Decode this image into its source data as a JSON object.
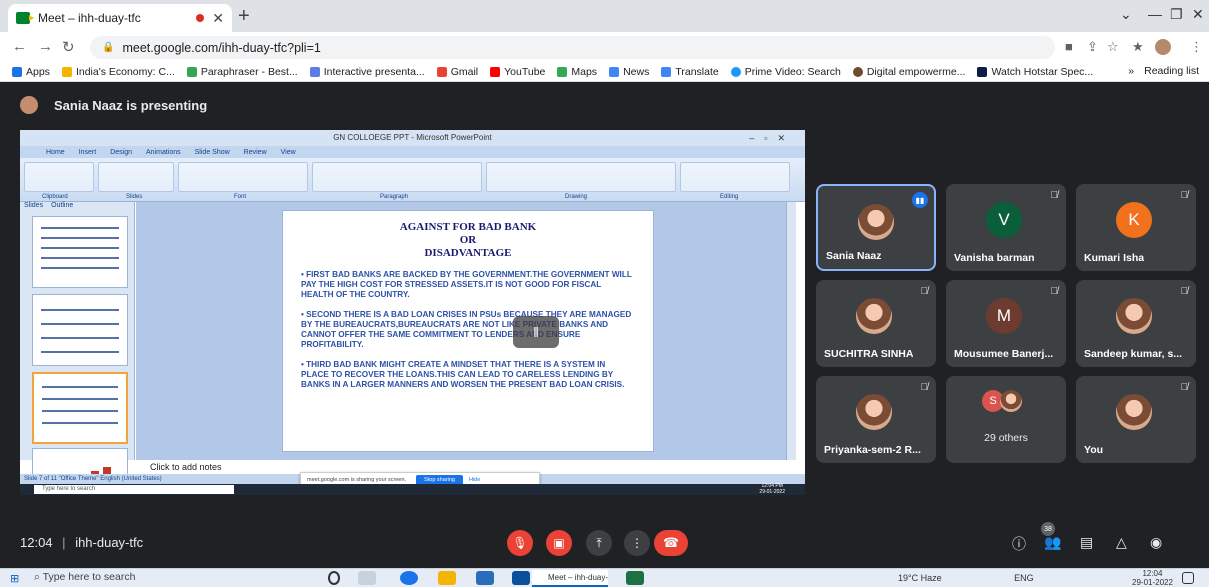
{
  "browser": {
    "tab_title": "Meet – ihh-duay-tfc",
    "url": "meet.google.com/ihh-duay-tfc?pli=1",
    "bookmarks": [
      "Apps",
      "India's Economy: C...",
      "Paraphraser - Best...",
      "Interactive presenta...",
      "Gmail",
      "YouTube",
      "Maps",
      "News",
      "Translate",
      "Prime Video: Search",
      "Digital empowerme...",
      "Watch Hotstar Spec..."
    ],
    "reading_list": "Reading list",
    "more": "»"
  },
  "meet": {
    "presenter_text": "Sania Naaz is presenting",
    "meeting_time": "12:04",
    "meeting_code": "ihh-duay-tfc",
    "participants_count": "38",
    "tiles": [
      {
        "name": "Sania Naaz",
        "initial": "",
        "color": "#3c4043",
        "muted": false,
        "speaking": true
      },
      {
        "name": "Vanisha barman",
        "initial": "V",
        "color": "#0b5e3a",
        "muted": true
      },
      {
        "name": "Kumari Isha",
        "initial": "K",
        "color": "#f2711c",
        "muted": true
      },
      {
        "name": "SUCHITRA SINHA",
        "initial": "",
        "color": "#3c4043",
        "muted": true
      },
      {
        "name": "Mousumee Banerj...",
        "initial": "M",
        "color": "#6d3b2f",
        "muted": true
      },
      {
        "name": "Sandeep kumar, s...",
        "initial": "",
        "color": "#3c4043",
        "muted": true
      },
      {
        "name": "Priyanka-sem-2 R...",
        "initial": "",
        "color": "#3c4043",
        "muted": true
      },
      {
        "name": "29 others",
        "initial": "S",
        "color": "#d9534f",
        "muted": false
      },
      {
        "name": "You",
        "initial": "",
        "color": "#3c4043",
        "muted": true
      }
    ]
  },
  "ppt": {
    "window_title": "GN COLLOEGE PPT - Microsoft PowerPoint",
    "tabs": [
      "Home",
      "Insert",
      "Design",
      "Animations",
      "Slide Show",
      "Review",
      "View"
    ],
    "groups": [
      "Clipboard",
      "Slides",
      "Font",
      "Paragraph",
      "Drawing",
      "Editing"
    ],
    "pane_tabs": [
      "Slides",
      "Outline"
    ],
    "slide_title_1": "AGAINST FOR BAD BANK",
    "slide_title_2": "OR",
    "slide_title_3": "DISADVANTAGE",
    "point_1": "• FIRST BAD BANKS ARE BACKED BY THE GOVERNMENT.THE GOVERNMENT WILL PAY THE HIGH COST FOR STRESSED ASSETS.IT IS NOT GOOD FOR FISCAL HEALTH OF THE COUNTRY.",
    "point_2": "• SECOND THERE IS A BAD LOAN CRISES IN PSUs BECAUSE THEY ARE MANAGED BY THE BUREAUCRATS,BUREAUCRATS ARE NOT LIKE PRIVATE BANKS AND CANNOT OFFER THE SAME COMMITMENT TO LENDERS AND ENSURE PROFITABILITY.",
    "point_3": "• THIRD BAD BANK MIGHT CREATE A MINDSET THAT THERE IS A SYSTEM IN PLACE TO RECOVER THE LOANS.THIS CAN LEAD TO CARELESS LENDING BY BANKS IN A LARGER MANNERS AND WORSEN THE PRESENT BAD LOAN CRISIS.",
    "notes": "Click to add notes",
    "status": "Slide 7 of 11   \"Office Theme\"   English (United States)",
    "sharing_text": "meet.google.com is sharing your screen.",
    "stop_sharing": "Stop sharing",
    "hide": "Hide",
    "inner_search": "Type here to search",
    "inner_clock": "12:04 PM",
    "inner_date": "29-01-2022"
  },
  "taskbar": {
    "search": "Type here to search",
    "meet_app": "Meet – ihh-duay-tfc...",
    "weather": "19°C Haze",
    "lang": "ENG",
    "time": "12:04",
    "date": "29-01-2022"
  }
}
